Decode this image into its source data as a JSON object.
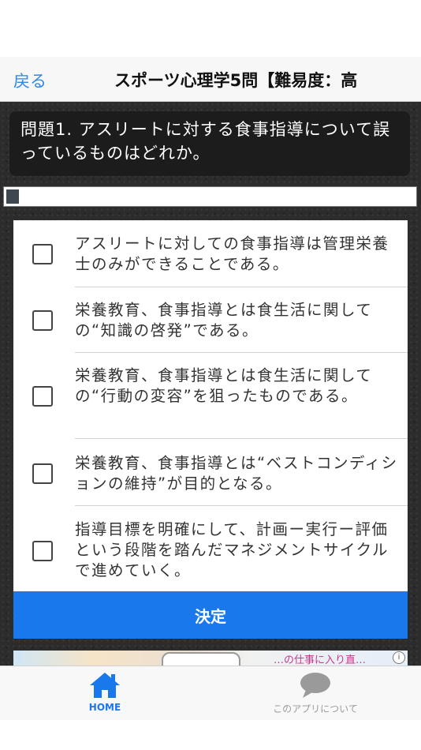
{
  "nav": {
    "back_label": "戻る",
    "title": "スポーツ心理学5問【難易度：高"
  },
  "question": {
    "text": "問題1. アスリートに対する食事指導について誤っているものはどれか。"
  },
  "progress": {
    "value": 0.03
  },
  "options": [
    {
      "text": "アスリートに対しての食事指導は管理栄養士のみができることである。",
      "checked": false
    },
    {
      "text": "栄養教育、食事指導とは食生活に関しての“知識の啓発”である。",
      "checked": false
    },
    {
      "text": "栄養教育、食事指導とは食生活に関しての“行動の変容”を狙ったものである。",
      "checked": false
    },
    {
      "text": "栄養教育、食事指導とは“ベストコンディションの維持”が目的となる。",
      "checked": false
    },
    {
      "text": "指導目標を明確にして、計画ー実行ー評価という段階を踏んだマネジメントサイクルで進めていく。",
      "checked": false
    }
  ],
  "decide_button": {
    "label": "決定"
  },
  "ad": {
    "text": "…の仕事に入り直…",
    "info_icon": "info-icon"
  },
  "tabs": [
    {
      "label": "HOME",
      "icon": "home-icon",
      "active": true
    },
    {
      "label": "このアプリについて",
      "icon": "speech-bubble-icon",
      "active": false
    }
  ],
  "colors": {
    "accent": "#1878ec",
    "link": "#2f86e8",
    "background": "#2c2c2c",
    "question_box": "#1c1c1c",
    "inactive_tab": "#9a9a9a"
  }
}
